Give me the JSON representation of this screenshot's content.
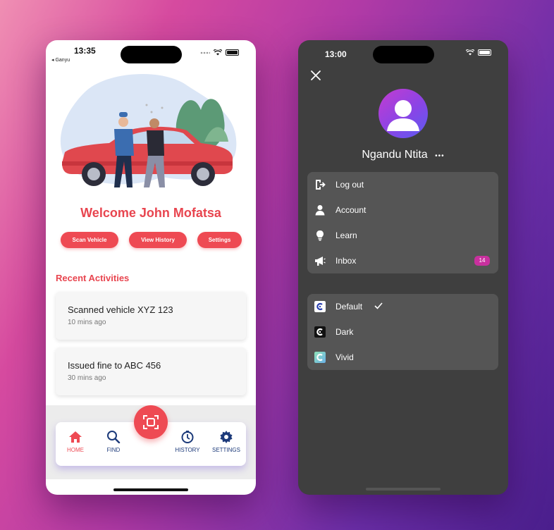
{
  "left_phone": {
    "status": {
      "time": "13:35",
      "back_app": "◂ Ganyu"
    },
    "welcome": "Welcome John Mofatsa",
    "actions": [
      {
        "label": "Scan Vehicle"
      },
      {
        "label": "View History"
      },
      {
        "label": "Settings"
      }
    ],
    "recent_title": "Recent Activities",
    "activities": [
      {
        "title": "Scanned vehicle XYZ 123",
        "time": "10 mins ago"
      },
      {
        "title": "Issued fine to ABC 456",
        "time": "30 mins ago"
      }
    ],
    "tabs": [
      {
        "label": "HOME",
        "icon": "home-icon",
        "active": true
      },
      {
        "label": "FIND",
        "icon": "search-icon",
        "active": false
      },
      {
        "label": "HISTORY",
        "icon": "history-icon",
        "active": false
      },
      {
        "label": "SETTINGS",
        "icon": "gear-icon",
        "active": false
      }
    ],
    "colors": {
      "accent": "#ee4a53",
      "nav": "#1c3a7a"
    }
  },
  "right_phone": {
    "status": {
      "time": "13:00"
    },
    "user_name": "Ngandu Ntita",
    "more_glyph": "•••",
    "menu": [
      {
        "label": "Log out",
        "icon": "logout-icon"
      },
      {
        "label": "Account",
        "icon": "person-icon"
      },
      {
        "label": "Learn",
        "icon": "lightbulb-icon"
      },
      {
        "label": "Inbox",
        "icon": "megaphone-icon",
        "badge": "14"
      }
    ],
    "themes": [
      {
        "label": "Default",
        "selected": true
      },
      {
        "label": "Dark",
        "selected": false
      },
      {
        "label": "Vivid",
        "selected": false
      }
    ],
    "colors": {
      "badge": "#c8309e",
      "panel": "#555555"
    }
  }
}
